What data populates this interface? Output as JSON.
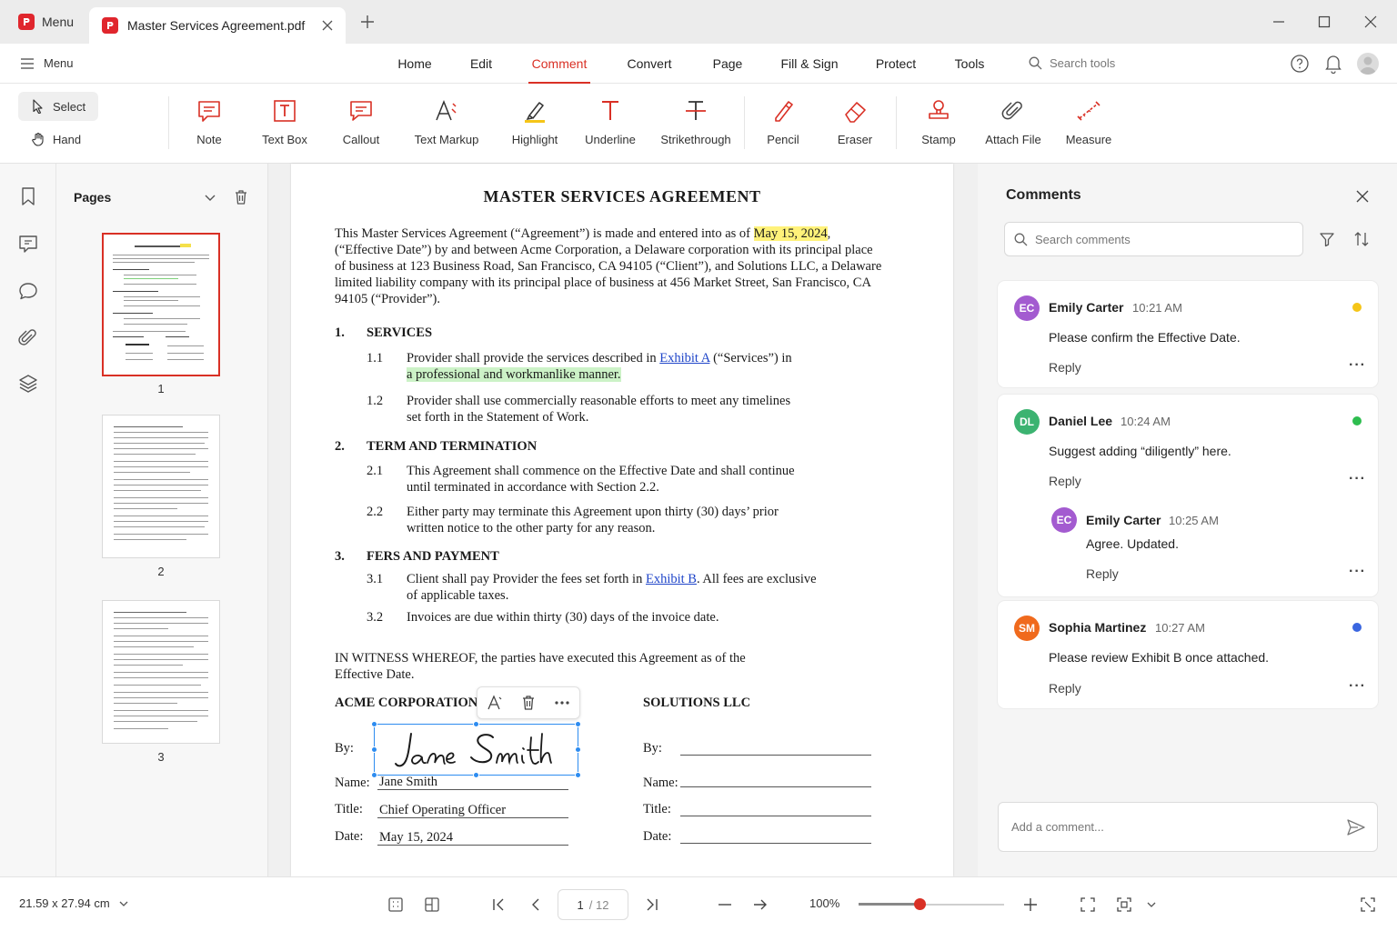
{
  "titlebar": {
    "menu_label": "Menu",
    "tab_title": "Master Services Agreement.pdf"
  },
  "navbar": {
    "menu_label": "Menu",
    "items": [
      "Home",
      "Edit",
      "Comment",
      "Convert",
      "Page",
      "Fill & Sign",
      "Protect",
      "Tools"
    ],
    "active": "Comment",
    "search_placeholder": "Search tools"
  },
  "ribbon": {
    "select_label": "Select",
    "hand_label": "Hand",
    "tools": [
      {
        "label": "Note",
        "icon": "note-icon"
      },
      {
        "label": "Text Box",
        "icon": "text-box-icon"
      },
      {
        "label": "Callout",
        "icon": "callout-icon"
      },
      {
        "label": "Text Markup",
        "icon": "text-markup-icon"
      },
      {
        "label": "Highlight",
        "icon": "highlight-icon"
      },
      {
        "label": "Underline",
        "icon": "underline-icon"
      },
      {
        "label": "Strikethrough",
        "icon": "strikethrough-icon"
      },
      {
        "label": "Pencil",
        "icon": "pencil-icon"
      },
      {
        "label": "Eraser",
        "icon": "eraser-icon"
      },
      {
        "label": "Stamp",
        "icon": "stamp-icon"
      },
      {
        "label": "Attach File",
        "icon": "paperclip-icon"
      },
      {
        "label": "Measure",
        "icon": "measure-icon"
      }
    ]
  },
  "pages_panel": {
    "title": "Pages",
    "pages": [
      "1",
      "2",
      "3"
    ],
    "selected": "1"
  },
  "document": {
    "title": "MASTER SERVICES AGREEMENT",
    "intro_1a": "This Master Services Agreement (“Agreement”) is made and entered into as of ",
    "intro_date": "May 15, 2024",
    "intro_1b": ",",
    "intro_2": "(“Effective Date”) by and between Acme Corporation, a Delaware corporation with its principal place",
    "intro_3": "of business at 123 Business Road, San Francisco, CA 94105 (“Client”), and Solutions LLC, a Delaware",
    "intro_4": "limited liability company with its principal place of business at 456 Market Street, San Francisco, CA",
    "intro_5": "94105 (“Provider”).",
    "s1_num": "1.",
    "s1_title": "SERVICES",
    "s1_1_num": "1.1",
    "s1_1_a": "Provider shall provide the services described in ",
    "s1_1_link": "Exhibit A",
    "s1_1_b": " (“Services”) in",
    "s1_1_c": "a professional and workmanlike manner.",
    "s1_2_num": "1.2",
    "s1_2_a": "Provider shall use commercially reasonable efforts to meet any timelines",
    "s1_2_b": "set forth in the Statement of Work.",
    "s2_num": "2.",
    "s2_title": "TERM AND TERMINATION",
    "s2_1_num": "2.1",
    "s2_1_a": "This Agreement shall commence on the Effective Date and shall continue",
    "s2_1_b": "until terminated in accordance with Section 2.2.",
    "s2_2_num": "2.2",
    "s2_2_a": "Either party may terminate this Agreement upon thirty (30) days’ prior",
    "s2_2_b": "written notice to the other party for any reason.",
    "s3_num": "3.",
    "s3_title": "FERS AND PAYMENT",
    "s3_1_num": "3.1",
    "s3_1_a": "Client shall pay Provider the fees set forth in ",
    "s3_1_link": "Exhibit B",
    "s3_1_b": ". All fees are exclusive",
    "s3_1_c": "of applicable taxes.",
    "s3_2_num": "3.2",
    "s3_2_a": "Invoices are due within thirty (30) days of the invoice date.",
    "witness_1": "IN WITNESS WHEREOF, the parties have executed this Agreement as of the",
    "witness_2": "Effective Date.",
    "left_party": "ACME CORPORATION",
    "right_party": "SOLUTIONS LLC",
    "by_label": "By:",
    "name_label": "Name:",
    "title_label": "Title:",
    "date_label": "Date:",
    "signature": "Jane Smith",
    "name_value": "Jane Smith",
    "title_value": "Chief Operating Officer",
    "date_value": "May 15, 2024"
  },
  "comments": {
    "title": "Comments",
    "search_placeholder": "Search comments",
    "add_placeholder": "Add a comment...",
    "reply_label": "Reply",
    "items": [
      {
        "initials": "EC",
        "author": "Emily Carter",
        "time": "10:21 AM",
        "text": "Please confirm the Effective Date.",
        "avatar_color": "#a35bd0",
        "dot_color": "#f5c518"
      },
      {
        "initials": "DL",
        "author": "Daniel Lee",
        "time": "10:24 AM",
        "text": "Suggest adding “diligently” here.",
        "avatar_color": "#3cb371",
        "dot_color": "#2ebd4f",
        "reply": {
          "initials": "EC",
          "author": "Emily Carter",
          "time": "10:25 AM",
          "text": "Agree. Updated.",
          "avatar_color": "#a35bd0"
        }
      },
      {
        "initials": "SM",
        "author": "Sophia Martinez",
        "time": "10:27 AM",
        "text": "Please review Exhibit B once attached.",
        "avatar_color": "#f06a1d",
        "dot_color": "#3a66e0"
      }
    ]
  },
  "statusbar": {
    "page_size": "21.59 x 27.94 cm",
    "current_page": "1",
    "total_pages": "/ 12",
    "zoom": "100%",
    "zoom_level": 0.42
  },
  "colors": {
    "accent": "#d93025",
    "selection": "#2d8cf0",
    "highlight_yellow": "#fff27a",
    "highlight_green": "#ccf2c7"
  }
}
